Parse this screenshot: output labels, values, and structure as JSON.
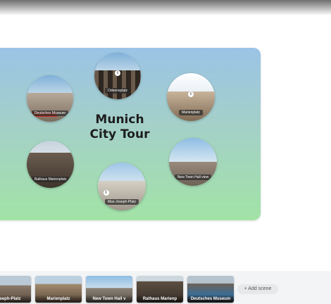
{
  "tour": {
    "title_line1": "Munich",
    "title_line2": "City Tour",
    "scenes": [
      {
        "name": "Odeonsplatz",
        "has_info": true
      },
      {
        "name": "Deutsches Museum",
        "has_info": false
      },
      {
        "name": "Marienplatz",
        "has_info": true
      },
      {
        "name": "Rathaus Marienplatz",
        "has_info": false
      },
      {
        "name": "New Town Hall view",
        "has_info": false
      },
      {
        "name": "Max-Joseph-Platz",
        "has_info": true
      }
    ],
    "info_symbol": "i"
  },
  "scene_strip": {
    "thumbnails": [
      {
        "label": "Joseph-Platz"
      },
      {
        "label": "Marienplatz"
      },
      {
        "label": "New Town Hall v"
      },
      {
        "label": "Rathaus Marienp"
      },
      {
        "label": "Deutsches Museum"
      }
    ],
    "add_scene_label": "+ Add scene"
  },
  "colors": {
    "card_top": "#9bc3e6",
    "card_bottom": "#a2e3a6",
    "strip_bg": "#f3f4f6"
  },
  "icons": [
    "info-icon",
    "plus-icon"
  ]
}
